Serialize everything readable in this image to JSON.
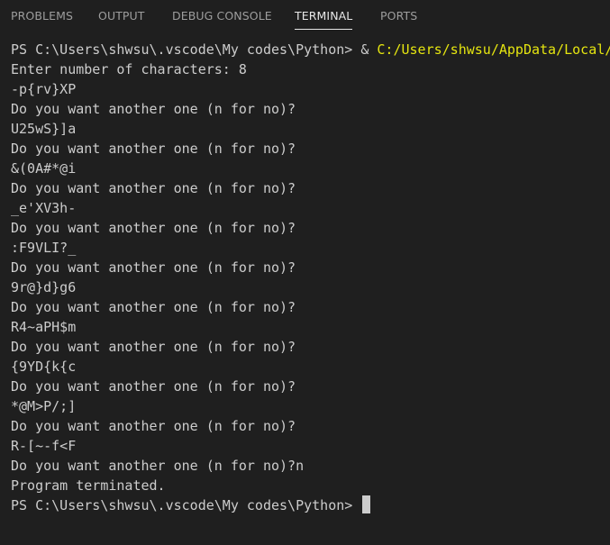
{
  "tabs": {
    "problems": "PROBLEMS",
    "output": "OUTPUT",
    "debug_console": "DEBUG CONSOLE",
    "terminal": "TERMINAL",
    "ports": "PORTS",
    "active": "TERMINAL"
  },
  "terminal": {
    "command_prompt": "PS C:\\Users\\shwsu\\.vscode\\My codes\\Python> ",
    "command_op": "& ",
    "command_path": "C:/Users/shwsu/AppData/Local/",
    "lines": [
      "Enter number of characters: 8",
      "-p{rv}XP",
      "Do you want another one (n for no)?",
      "U25wS}]a",
      "Do you want another one (n for no)?",
      "&(0A#*@i",
      "Do you want another one (n for no)?",
      "_e'XV3h-",
      "Do you want another one (n for no)?",
      ":F9VLI?_",
      "Do you want another one (n for no)?",
      "9r@}d}g6",
      "Do you want another one (n for no)?",
      "R4~aPH$m",
      "Do you want another one (n for no)?",
      "{9YD{k{c",
      "Do you want another one (n for no)?",
      "*@M>P/;]",
      "Do you want another one (n for no)?",
      "R-[~-f<F",
      "Do you want another one (n for no)?n",
      "Program terminated."
    ],
    "final_prompt": "PS C:\\Users\\shwsu\\.vscode\\My codes\\Python> "
  }
}
